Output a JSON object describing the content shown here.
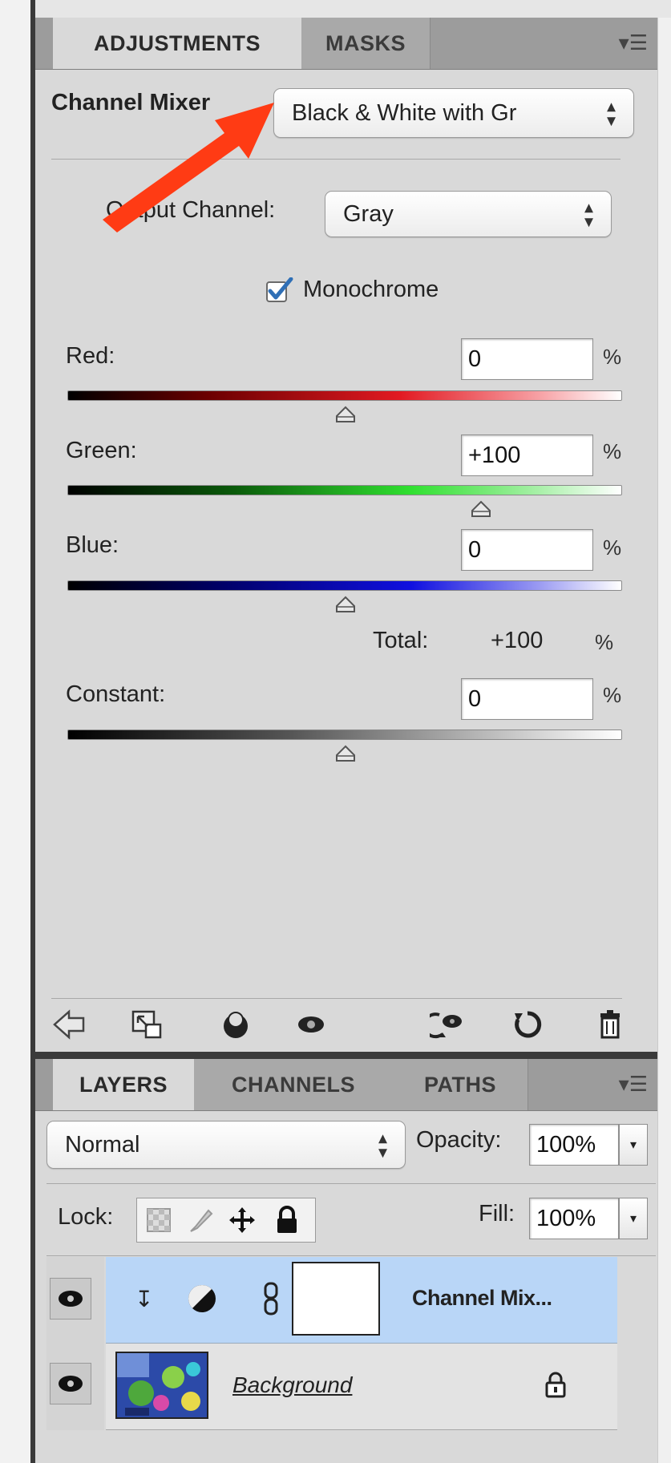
{
  "adjustments_panel": {
    "tabs": [
      {
        "label": "ADJUSTMENTS",
        "active": true
      },
      {
        "label": "MASKS",
        "active": false
      }
    ],
    "title": "Channel Mixer",
    "preset": {
      "value": "Black & White with Gr"
    },
    "output_channel": {
      "label": "Output Channel:",
      "value": "Gray"
    },
    "monochrome": {
      "label": "Monochrome",
      "checked": true
    },
    "sliders": [
      {
        "name": "red",
        "label": "Red:",
        "field_value": "0",
        "unit": "%",
        "value": 0
      },
      {
        "name": "green",
        "label": "Green:",
        "field_value": "+100",
        "unit": "%",
        "value": 100
      },
      {
        "name": "blue",
        "label": "Blue:",
        "field_value": "0",
        "unit": "%",
        "value": 0
      }
    ],
    "total": {
      "label": "Total:",
      "value": "+100",
      "unit": "%"
    },
    "constant": {
      "label": "Constant:",
      "field_value": "0",
      "unit": "%",
      "value": 0
    },
    "toolbar_icons": [
      "back-arrow-icon",
      "expand-view-icon",
      "clip-to-layer-icon",
      "visibility-icon",
      "view-previous-state-icon",
      "reset-icon",
      "trash-icon"
    ]
  },
  "layers_panel": {
    "tabs": [
      {
        "label": "LAYERS",
        "active": true
      },
      {
        "label": "CHANNELS",
        "active": false
      },
      {
        "label": "PATHS",
        "active": false
      }
    ],
    "blend_mode": "Normal",
    "opacity": {
      "label": "Opacity:",
      "value": "100%"
    },
    "lock_label": "Lock:",
    "fill": {
      "label": "Fill:",
      "value": "100%"
    },
    "layers": [
      {
        "name": "Channel Mix...",
        "selected": true,
        "type": "adjustment"
      },
      {
        "name": "Background",
        "selected": false,
        "type": "image",
        "locked": true
      }
    ]
  },
  "colors": {
    "selection": "#b9d6f7",
    "annotation_arrow": "#ff3b14",
    "checkbox": "#2f6fb6"
  }
}
